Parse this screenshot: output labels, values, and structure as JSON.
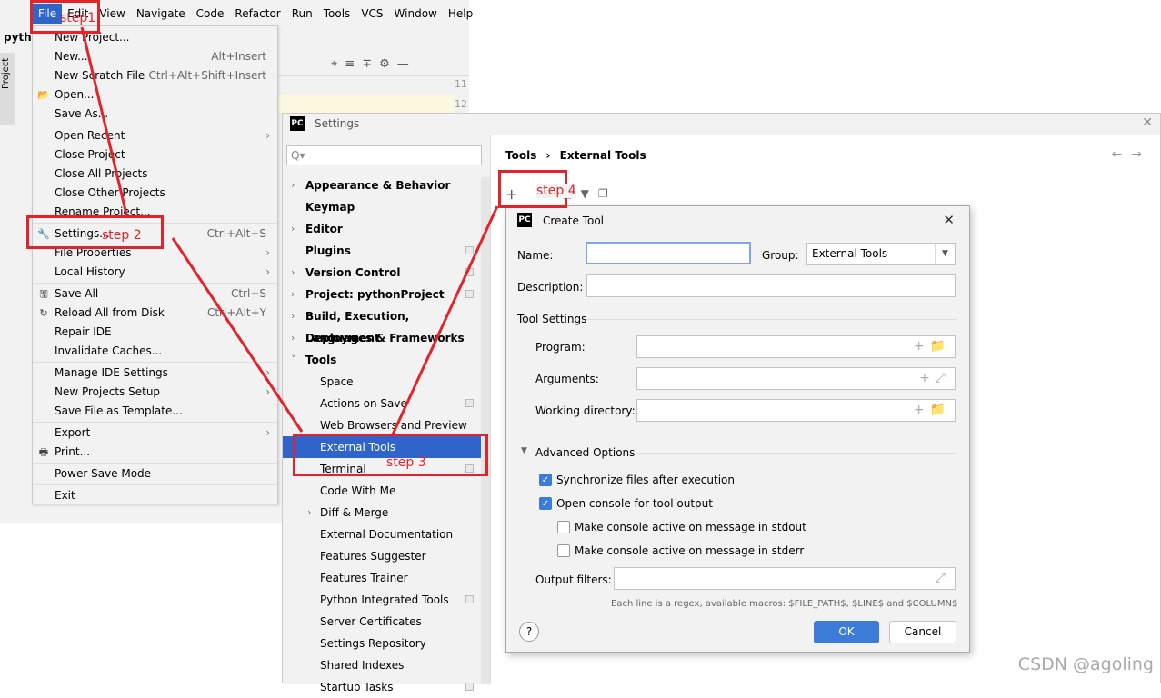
{
  "ide": {
    "app_icon": "PC",
    "title": "pyth",
    "side_tab": "Project",
    "menubar": [
      "File",
      "Edit",
      "View",
      "Navigate",
      "Code",
      "Refactor",
      "Run",
      "Tools",
      "VCS",
      "Window",
      "Help"
    ],
    "gutter": [
      "11",
      "12"
    ]
  },
  "file_menu": {
    "items": [
      {
        "label": "New Project...",
        "shortcut": "",
        "submenu": false,
        "icon": ""
      },
      {
        "label": "New...",
        "shortcut": "Alt+Insert",
        "submenu": false,
        "icon": ""
      },
      {
        "label": "New Scratch File",
        "shortcut": "Ctrl+Alt+Shift+Insert",
        "submenu": false,
        "icon": ""
      },
      {
        "label": "Open...",
        "shortcut": "",
        "submenu": false,
        "icon": "folder-icon"
      },
      {
        "label": "Save As...",
        "shortcut": "",
        "submenu": false,
        "icon": ""
      },
      {
        "label": "Open Recent",
        "shortcut": "",
        "submenu": true,
        "icon": ""
      },
      {
        "label": "Close Project",
        "shortcut": "",
        "submenu": false,
        "icon": ""
      },
      {
        "label": "Close All Projects",
        "shortcut": "",
        "submenu": false,
        "icon": ""
      },
      {
        "label": "Close Other Projects",
        "shortcut": "",
        "submenu": false,
        "icon": ""
      },
      {
        "label": "Rename Project...",
        "shortcut": "",
        "submenu": false,
        "icon": ""
      },
      {
        "label": "Settings...",
        "shortcut": "Ctrl+Alt+S",
        "submenu": false,
        "icon": "wrench-icon"
      },
      {
        "label": "File Properties",
        "shortcut": "",
        "submenu": true,
        "icon": ""
      },
      {
        "label": "Local History",
        "shortcut": "",
        "submenu": true,
        "icon": ""
      },
      {
        "label": "Save All",
        "shortcut": "Ctrl+S",
        "submenu": false,
        "icon": "save-icon"
      },
      {
        "label": "Reload All from Disk",
        "shortcut": "Ctrl+Alt+Y",
        "submenu": false,
        "icon": "reload-icon"
      },
      {
        "label": "Repair IDE",
        "shortcut": "",
        "submenu": false,
        "icon": ""
      },
      {
        "label": "Invalidate Caches...",
        "shortcut": "",
        "submenu": false,
        "icon": ""
      },
      {
        "label": "Manage IDE Settings",
        "shortcut": "",
        "submenu": true,
        "icon": ""
      },
      {
        "label": "New Projects Setup",
        "shortcut": "",
        "submenu": true,
        "icon": ""
      },
      {
        "label": "Save File as Template...",
        "shortcut": "",
        "submenu": false,
        "icon": ""
      },
      {
        "label": "Export",
        "shortcut": "",
        "submenu": true,
        "icon": ""
      },
      {
        "label": "Print...",
        "shortcut": "",
        "submenu": false,
        "icon": "print-icon"
      },
      {
        "label": "Power Save Mode",
        "shortcut": "",
        "submenu": false,
        "icon": ""
      },
      {
        "label": "Exit",
        "shortcut": "",
        "submenu": false,
        "icon": ""
      }
    ]
  },
  "settings": {
    "app_icon": "PC",
    "title": "Settings",
    "search_placeholder": "Q▾",
    "tree": [
      {
        "label": "Appearance & Behavior",
        "bold": true,
        "level": 0,
        "expander": "›",
        "page_icon": false
      },
      {
        "label": "Keymap",
        "bold": true,
        "level": 0,
        "expander": "",
        "page_icon": false
      },
      {
        "label": "Editor",
        "bold": true,
        "level": 0,
        "expander": "›",
        "page_icon": false
      },
      {
        "label": "Plugins",
        "bold": true,
        "level": 0,
        "expander": "",
        "page_icon": true
      },
      {
        "label": "Version Control",
        "bold": true,
        "level": 0,
        "expander": "›",
        "page_icon": true
      },
      {
        "label": "Project: pythonProject",
        "bold": true,
        "level": 0,
        "expander": "›",
        "page_icon": true
      },
      {
        "label": "Build, Execution, Deployment",
        "bold": true,
        "level": 0,
        "expander": "›",
        "page_icon": false
      },
      {
        "label": "Languages & Frameworks",
        "bold": true,
        "level": 0,
        "expander": "›",
        "page_icon": false
      },
      {
        "label": "Tools",
        "bold": true,
        "level": 0,
        "expander": "˅",
        "page_icon": false
      },
      {
        "label": "Space",
        "bold": false,
        "level": 1,
        "expander": "",
        "page_icon": false
      },
      {
        "label": "Actions on Save",
        "bold": false,
        "level": 1,
        "expander": "",
        "page_icon": true
      },
      {
        "label": "Web Browsers and Preview",
        "bold": false,
        "level": 1,
        "expander": "",
        "page_icon": false
      },
      {
        "label": "External Tools",
        "bold": false,
        "level": 1,
        "expander": "",
        "page_icon": false,
        "selected": true
      },
      {
        "label": "Terminal",
        "bold": false,
        "level": 1,
        "expander": "",
        "page_icon": true
      },
      {
        "label": "Code With Me",
        "bold": false,
        "level": 1,
        "expander": "",
        "page_icon": false
      },
      {
        "label": "Diff & Merge",
        "bold": false,
        "level": 1,
        "expander": "›",
        "page_icon": false
      },
      {
        "label": "External Documentation",
        "bold": false,
        "level": 1,
        "expander": "",
        "page_icon": false
      },
      {
        "label": "Features Suggester",
        "bold": false,
        "level": 1,
        "expander": "",
        "page_icon": false
      },
      {
        "label": "Features Trainer",
        "bold": false,
        "level": 1,
        "expander": "",
        "page_icon": false
      },
      {
        "label": "Python Integrated Tools",
        "bold": false,
        "level": 1,
        "expander": "",
        "page_icon": true
      },
      {
        "label": "Server Certificates",
        "bold": false,
        "level": 1,
        "expander": "",
        "page_icon": false
      },
      {
        "label": "Settings Repository",
        "bold": false,
        "level": 1,
        "expander": "",
        "page_icon": false
      },
      {
        "label": "Shared Indexes",
        "bold": false,
        "level": 1,
        "expander": "",
        "page_icon": false
      },
      {
        "label": "Startup Tasks",
        "bold": false,
        "level": 1,
        "expander": "",
        "page_icon": true
      }
    ],
    "breadcrumb": {
      "parent": "Tools",
      "sep": "›",
      "current": "External Tools"
    },
    "nav_arrows": "←→"
  },
  "create_tool": {
    "app_icon": "PC",
    "title": "Create Tool",
    "name_label": "Name:",
    "name_value": "",
    "group_label": "Group:",
    "group_value": "External Tools",
    "description_label": "Description:",
    "description_value": "",
    "tool_settings_label": "Tool Settings",
    "program_label": "Program:",
    "arguments_label": "Arguments:",
    "working_dir_label": "Working directory:",
    "advanced_label": "Advanced Options",
    "checkboxes": [
      {
        "label": "Synchronize files after execution",
        "checked": true
      },
      {
        "label": "Open console for tool output",
        "checked": true
      },
      {
        "label": "Make console active on message in stdout",
        "checked": false
      },
      {
        "label": "Make console active on message in stderr",
        "checked": false
      }
    ],
    "output_filters_label": "Output filters:",
    "macros_hint": "Each line is a regex, available macros: $FILE_PATH$, $LINE$ and $COLUMN$",
    "help_label": "?",
    "ok_label": "OK",
    "cancel_label": "Cancel"
  },
  "annotations": {
    "step1": "step1",
    "step2": "step 2",
    "step3": "step 3",
    "step4": "step 4",
    "color": "#e0242a"
  },
  "watermark": "CSDN @agoling"
}
